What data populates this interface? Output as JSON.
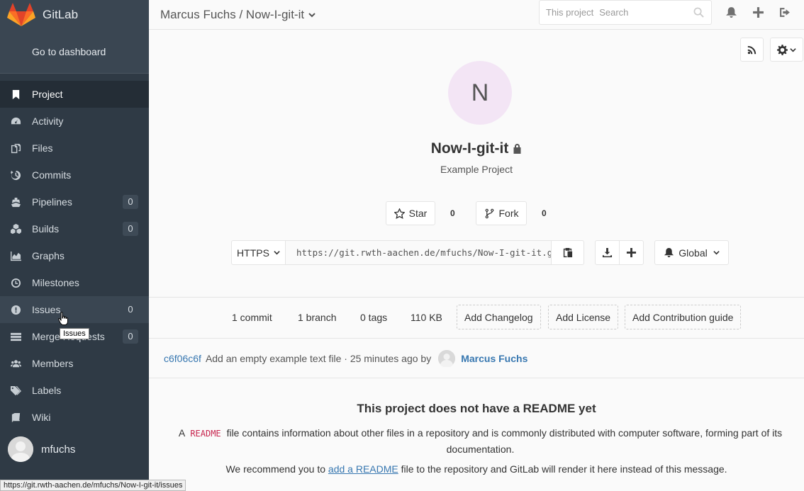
{
  "brand": {
    "name": "GitLab"
  },
  "sidebar": {
    "dashboard_link": "Go to dashboard",
    "items": [
      {
        "label": "Project",
        "icon": "bookmark-icon"
      },
      {
        "label": "Activity",
        "icon": "dashboard-icon"
      },
      {
        "label": "Files",
        "icon": "files-icon"
      },
      {
        "label": "Commits",
        "icon": "history-icon"
      },
      {
        "label": "Pipelines",
        "icon": "ship-icon",
        "badge": "0"
      },
      {
        "label": "Builds",
        "icon": "cubes-icon",
        "badge": "0"
      },
      {
        "label": "Graphs",
        "icon": "area-chart-icon"
      },
      {
        "label": "Milestones",
        "icon": "clock-icon"
      },
      {
        "label": "Issues",
        "icon": "exclamation-circle-icon",
        "badge": "0"
      },
      {
        "label": "Merge Requests",
        "icon": "tasks-icon",
        "badge": "0"
      },
      {
        "label": "Members",
        "icon": "users-icon"
      },
      {
        "label": "Labels",
        "icon": "tags-icon"
      },
      {
        "label": "Wiki",
        "icon": "book-icon"
      }
    ],
    "username": "mfuchs"
  },
  "tooltip": "Issues",
  "statusbar_url": "https://git.rwth-aachen.de/mfuchs/Now-I-git-it/issues",
  "header": {
    "title": "Marcus Fuchs / Now-I-git-it",
    "search_scope": "This project",
    "search_placeholder": "Search"
  },
  "project": {
    "avatar_letter": "N",
    "name": "Now-I-git-it",
    "description": "Example Project",
    "star_label": "Star",
    "star_count": "0",
    "fork_label": "Fork",
    "fork_count": "0",
    "protocol": "HTTPS",
    "clone_url": "https://git.rwth-aachen.de/mfuchs/Now-I-git-it.git",
    "notification_level": "Global"
  },
  "stats": {
    "commits": "1 commit",
    "branches": "1 branch",
    "tags": "0 tags",
    "size": "110 KB",
    "add_changelog": "Add Changelog",
    "add_license": "Add License",
    "add_contribution": "Add Contribution guide"
  },
  "last_commit": {
    "sha": "c6f06c6f",
    "message": "Add an empty example text file · 25 minutes ago by",
    "author": "Marcus Fuchs"
  },
  "readme": {
    "title": "This project does not have a README yet",
    "p1_before": "A",
    "p1_code": "README",
    "p1_after": "file contains information about other files in a repository and is commonly distributed with computer software, forming part of its documentation.",
    "p2_before": "We recommend you to",
    "p2_link": "add a README",
    "p2_after": "file to the repository and GitLab will render it here instead of this message."
  }
}
